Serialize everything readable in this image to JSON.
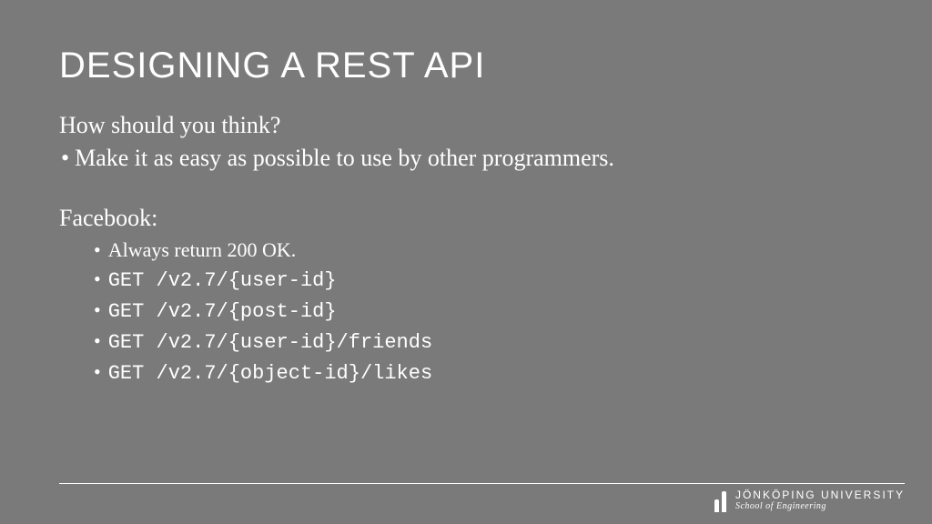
{
  "title": "DESIGNING A REST API",
  "subtitle": "How should you think?",
  "mainBullet": "Make it as easy as possible to use by other programmers.",
  "sectionLabel": "Facebook:",
  "subBullets": [
    {
      "text": "Always return 200 OK.",
      "mono": false
    },
    {
      "text": "GET /v2.7/{user-id}",
      "mono": true
    },
    {
      "text": "GET /v2.7/{post-id}",
      "mono": true
    },
    {
      "text": "GET /v2.7/{user-id}/friends",
      "mono": true
    },
    {
      "text": "GET /v2.7/{object-id}/likes",
      "mono": true
    }
  ],
  "brand": {
    "name": "JÖNKÖPING UNIVERSITY",
    "school": "School of Engineering"
  }
}
